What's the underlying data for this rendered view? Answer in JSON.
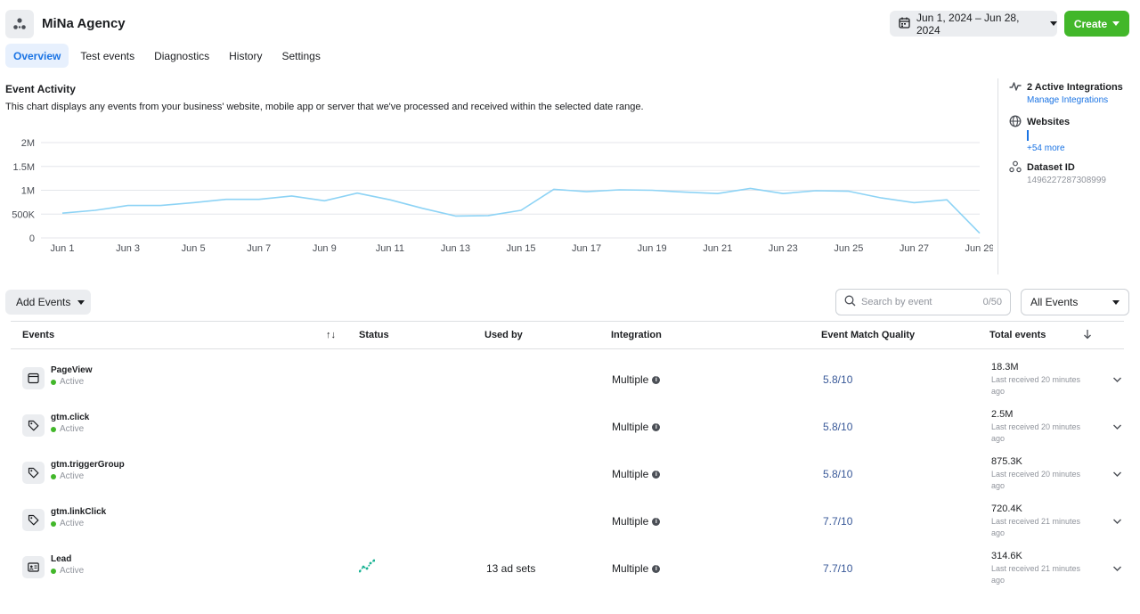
{
  "header": {
    "title": "MiNa Agency",
    "date_range": "Jun 1, 2024 – Jun 28, 2024",
    "create_label": "Create"
  },
  "tabs": [
    {
      "label": "Overview",
      "active": true
    },
    {
      "label": "Test events",
      "active": false
    },
    {
      "label": "Diagnostics",
      "active": false
    },
    {
      "label": "History",
      "active": false
    },
    {
      "label": "Settings",
      "active": false
    }
  ],
  "activity": {
    "title": "Event Activity",
    "description": "This chart displays any events from your business' website, mobile app or server that we've processed and received within the selected date range."
  },
  "chart_data": {
    "type": "line",
    "y_ticks": [
      "2M",
      "1.5M",
      "1M",
      "500K",
      "0"
    ],
    "x_ticks": [
      "Jun 1",
      "Jun 3",
      "Jun 5",
      "Jun 7",
      "Jun 9",
      "Jun 11",
      "Jun 13",
      "Jun 15",
      "Jun 17",
      "Jun 19",
      "Jun 21",
      "Jun 23",
      "Jun 25",
      "Jun 27",
      "Jun 29"
    ],
    "ylim": [
      0,
      2000000
    ],
    "grid": true,
    "series": [
      {
        "color": "#8dd3f5",
        "x": [
          "Jun 1",
          "Jun 2",
          "Jun 3",
          "Jun 4",
          "Jun 5",
          "Jun 6",
          "Jun 7",
          "Jun 8",
          "Jun 9",
          "Jun 10",
          "Jun 11",
          "Jun 12",
          "Jun 13",
          "Jun 14",
          "Jun 15",
          "Jun 16",
          "Jun 17",
          "Jun 18",
          "Jun 19",
          "Jun 20",
          "Jun 21",
          "Jun 22",
          "Jun 23",
          "Jun 24",
          "Jun 25",
          "Jun 26",
          "Jun 27",
          "Jun 28",
          "Jun 29"
        ],
        "values": [
          520000,
          580000,
          680000,
          680000,
          740000,
          810000,
          810000,
          880000,
          780000,
          940000,
          800000,
          620000,
          460000,
          470000,
          580000,
          1020000,
          970000,
          1010000,
          1000000,
          960000,
          930000,
          1040000,
          930000,
          990000,
          980000,
          840000,
          740000,
          800000,
          100000
        ]
      }
    ]
  },
  "sidebar": {
    "integrations_label": "2 Active Integrations",
    "integrations_link": "Manage Integrations",
    "websites_label": "Websites",
    "websites_more": "+54 more",
    "dataset_label": "Dataset ID",
    "dataset_id": "1496227287308999"
  },
  "controls": {
    "add_events_label": "Add Events",
    "search_placeholder": "Search by event",
    "search_count": "0/50",
    "filter_label": "All Events"
  },
  "table": {
    "columns": {
      "events": "Events",
      "sort_icon": "↑↓",
      "status": "Status",
      "used_by": "Used by",
      "integration": "Integration",
      "emq": "Event Match Quality",
      "total": "Total events"
    },
    "rows": [
      {
        "name": "PageView",
        "status": "Active",
        "icon": "browser-window-icon",
        "used_by": "",
        "integration": "Multiple",
        "emq": "5.8/10",
        "total": "18.3M",
        "last": "Last received 20 minutes ago"
      },
      {
        "name": "gtm.click",
        "status": "Active",
        "icon": "tag-icon",
        "used_by": "",
        "integration": "Multiple",
        "emq": "5.8/10",
        "total": "2.5M",
        "last": "Last received 20 minutes ago"
      },
      {
        "name": "gtm.triggerGroup",
        "status": "Active",
        "icon": "tag-icon",
        "used_by": "",
        "integration": "Multiple",
        "emq": "5.8/10",
        "total": "875.3K",
        "last": "Last received 20 minutes ago"
      },
      {
        "name": "gtm.linkClick",
        "status": "Active",
        "icon": "tag-icon",
        "used_by": "",
        "integration": "Multiple",
        "emq": "7.7/10",
        "total": "720.4K",
        "last": "Last received 21 minutes ago"
      },
      {
        "name": "Lead",
        "status": "Active",
        "icon": "id-card-icon",
        "used_by": "13 ad sets",
        "integration": "Multiple",
        "emq": "7.7/10",
        "total": "314.6K",
        "last": "Last received 21 minutes ago"
      }
    ]
  }
}
